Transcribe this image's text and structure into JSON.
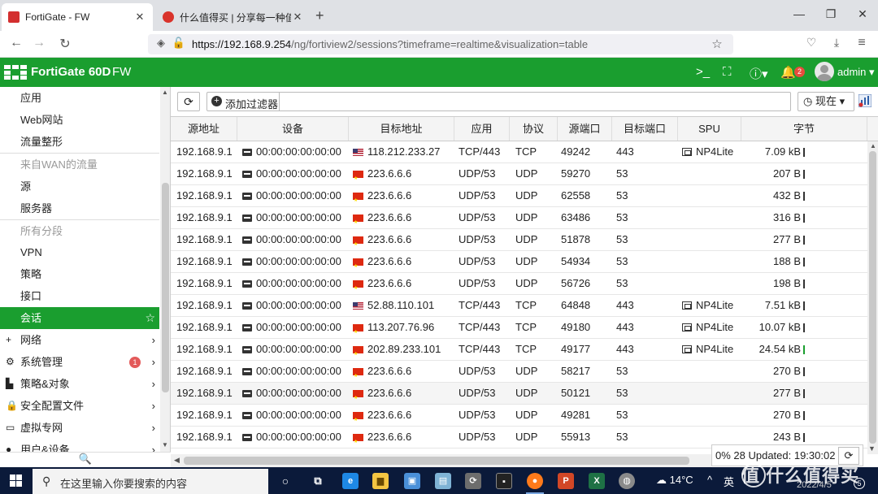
{
  "browser": {
    "tabs": [
      {
        "title": "FortiGate - FW",
        "active": true
      },
      {
        "title": "什么值得买 | 分享每一种值",
        "active": false
      }
    ],
    "new_tab": "+",
    "url_host": "https://192.168.9.254",
    "url_path": "/ng/fortiview2/sessions?timeframe=realtime&visualization=table"
  },
  "fg_header": {
    "title": "FortiGate 60D",
    "subtitle": "FW",
    "notif_count": "2",
    "user": "admin"
  },
  "sidebar": {
    "items": [
      {
        "label": "应用",
        "type": "item"
      },
      {
        "label": "Web网站",
        "type": "item"
      },
      {
        "label": "流量整形",
        "type": "item"
      },
      {
        "label": "来自WAN的流量",
        "type": "header"
      },
      {
        "label": "源",
        "type": "item"
      },
      {
        "label": "服务器",
        "type": "item"
      },
      {
        "label": "所有分段",
        "type": "header"
      },
      {
        "label": "VPN",
        "type": "item"
      },
      {
        "label": "策略",
        "type": "item"
      },
      {
        "label": "接口",
        "type": "item"
      },
      {
        "label": "会话",
        "type": "active"
      },
      {
        "label": "网络",
        "type": "group",
        "icon": "+"
      },
      {
        "label": "系统管理",
        "type": "group",
        "icon": "⚙",
        "badge": "1"
      },
      {
        "label": "策略&对象",
        "type": "group",
        "icon": "▙"
      },
      {
        "label": "安全配置文件",
        "type": "group",
        "icon": "🔒"
      },
      {
        "label": "虚拟专网",
        "type": "group",
        "icon": "▭"
      },
      {
        "label": "用户&设备",
        "type": "group",
        "icon": "●"
      }
    ]
  },
  "toolbar": {
    "add_filter": "添加过滤器",
    "now": "现在"
  },
  "table": {
    "columns": [
      "源地址",
      "设备",
      "目标地址",
      "应用",
      "协议",
      "源端口",
      "目标端口",
      "SPU",
      "字节"
    ],
    "rows": [
      {
        "src": "192.168.9.1",
        "device": "00:00:00:00:00:00",
        "flag": "us",
        "dst": "118.212.233.27",
        "app": "TCP/443",
        "proto": "TCP",
        "sport": "49242",
        "dport": "443",
        "spu": "NP4Lite",
        "bytes": "7.09 kB"
      },
      {
        "src": "192.168.9.1",
        "device": "00:00:00:00:00:00",
        "flag": "cn",
        "dst": "223.6.6.6",
        "app": "UDP/53",
        "proto": "UDP",
        "sport": "59270",
        "dport": "53",
        "spu": "",
        "bytes": "207 B"
      },
      {
        "src": "192.168.9.1",
        "device": "00:00:00:00:00:00",
        "flag": "cn",
        "dst": "223.6.6.6",
        "app": "UDP/53",
        "proto": "UDP",
        "sport": "62558",
        "dport": "53",
        "spu": "",
        "bytes": "432 B"
      },
      {
        "src": "192.168.9.1",
        "device": "00:00:00:00:00:00",
        "flag": "cn",
        "dst": "223.6.6.6",
        "app": "UDP/53",
        "proto": "UDP",
        "sport": "63486",
        "dport": "53",
        "spu": "",
        "bytes": "316 B"
      },
      {
        "src": "192.168.9.1",
        "device": "00:00:00:00:00:00",
        "flag": "cn",
        "dst": "223.6.6.6",
        "app": "UDP/53",
        "proto": "UDP",
        "sport": "51878",
        "dport": "53",
        "spu": "",
        "bytes": "277 B"
      },
      {
        "src": "192.168.9.1",
        "device": "00:00:00:00:00:00",
        "flag": "cn",
        "dst": "223.6.6.6",
        "app": "UDP/53",
        "proto": "UDP",
        "sport": "54934",
        "dport": "53",
        "spu": "",
        "bytes": "188 B"
      },
      {
        "src": "192.168.9.1",
        "device": "00:00:00:00:00:00",
        "flag": "cn",
        "dst": "223.6.6.6",
        "app": "UDP/53",
        "proto": "UDP",
        "sport": "56726",
        "dport": "53",
        "spu": "",
        "bytes": "198 B"
      },
      {
        "src": "192.168.9.1",
        "device": "00:00:00:00:00:00",
        "flag": "us",
        "dst": "52.88.110.101",
        "app": "TCP/443",
        "proto": "TCP",
        "sport": "64848",
        "dport": "443",
        "spu": "NP4Lite",
        "bytes": "7.51 kB"
      },
      {
        "src": "192.168.9.1",
        "device": "00:00:00:00:00:00",
        "flag": "cn",
        "dst": "113.207.76.96",
        "app": "TCP/443",
        "proto": "TCP",
        "sport": "49180",
        "dport": "443",
        "spu": "NP4Lite",
        "bytes": "10.07 kB"
      },
      {
        "src": "192.168.9.1",
        "device": "00:00:00:00:00:00",
        "flag": "cn",
        "dst": "202.89.233.101",
        "app": "TCP/443",
        "proto": "TCP",
        "sport": "49177",
        "dport": "443",
        "spu": "NP4Lite",
        "bytes": "24.54 kB"
      },
      {
        "src": "192.168.9.1",
        "device": "00:00:00:00:00:00",
        "flag": "cn",
        "dst": "223.6.6.6",
        "app": "UDP/53",
        "proto": "UDP",
        "sport": "58217",
        "dport": "53",
        "spu": "",
        "bytes": "270 B"
      },
      {
        "src": "192.168.9.1",
        "device": "00:00:00:00:00:00",
        "flag": "cn",
        "dst": "223.6.6.6",
        "app": "UDP/53",
        "proto": "UDP",
        "sport": "50121",
        "dport": "53",
        "spu": "",
        "bytes": "277 B"
      },
      {
        "src": "192.168.9.1",
        "device": "00:00:00:00:00:00",
        "flag": "cn",
        "dst": "223.6.6.6",
        "app": "UDP/53",
        "proto": "UDP",
        "sport": "49281",
        "dport": "53",
        "spu": "",
        "bytes": "270 B"
      },
      {
        "src": "192.168.9.1",
        "device": "00:00:00:00:00:00",
        "flag": "cn",
        "dst": "223.6.6.6",
        "app": "UDP/53",
        "proto": "UDP",
        "sport": "55913",
        "dport": "53",
        "spu": "",
        "bytes": "243 B"
      }
    ]
  },
  "status": {
    "text": "0% 28  Updated: 19:30:02"
  },
  "taskbar": {
    "search_placeholder": "在这里输入你要搜索的内容",
    "weather": "14°C",
    "tray_lang": "英",
    "date": "2022/4/5",
    "notif_count": "5"
  },
  "watermark": "值 什么值得买",
  "colors": {
    "fortinet_green": "#1a9e2f",
    "taskbar": "#0b1a3a"
  }
}
